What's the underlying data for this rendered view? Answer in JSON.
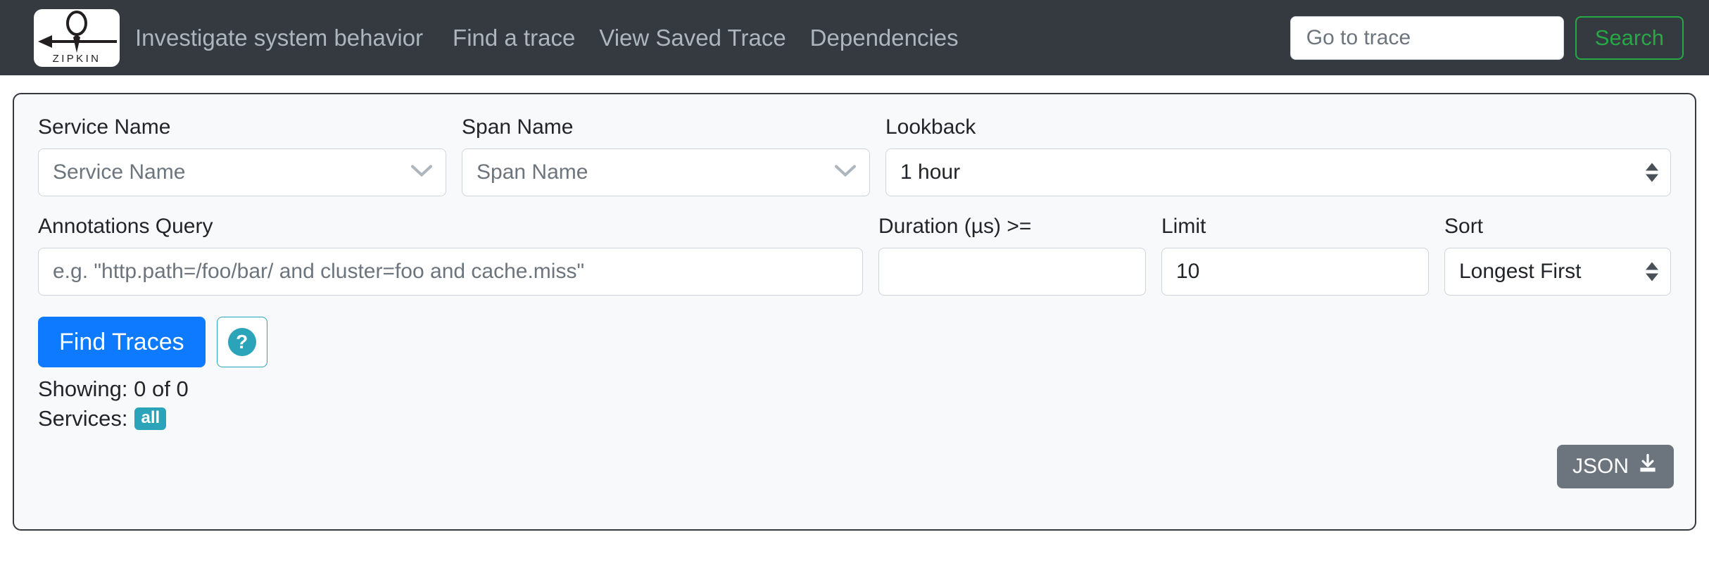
{
  "navbar": {
    "logo_text": "ZIPKIN",
    "tagline": "Investigate system behavior",
    "links": [
      {
        "label": "Find a trace"
      },
      {
        "label": "View Saved Trace"
      },
      {
        "label": "Dependencies"
      }
    ],
    "trace_search": {
      "placeholder": "Go to trace",
      "value": ""
    },
    "search_button": "Search",
    "background_color": "#343a40",
    "link_color": "#adb5bd",
    "search_accent": "#28a745"
  },
  "search_form": {
    "service_name": {
      "label": "Service Name",
      "value": "Service Name",
      "is_placeholder": true
    },
    "span_name": {
      "label": "Span Name",
      "value": "Span Name",
      "is_placeholder": true
    },
    "lookback": {
      "label": "Lookback",
      "value": "1 hour"
    },
    "annotations_query": {
      "label": "Annotations Query",
      "placeholder": "e.g. \"http.path=/foo/bar/ and cluster=foo and cache.miss\"",
      "value": ""
    },
    "duration": {
      "label": "Duration (µs) >=",
      "value": "",
      "placeholder": ""
    },
    "limit": {
      "label": "Limit",
      "value": "10"
    },
    "sort": {
      "label": "Sort",
      "value": "Longest First"
    }
  },
  "actions": {
    "find_traces_label": "Find Traces",
    "find_traces_color": "#0d7aff",
    "help_glyph": "?",
    "help_color": "#2BA3B8",
    "json_label": "JSON",
    "json_color": "#6c757d"
  },
  "status": {
    "showing": "Showing: 0 of 0",
    "services_label": "Services:",
    "services_badge": "all",
    "badge_color": "#2BA3B8"
  }
}
